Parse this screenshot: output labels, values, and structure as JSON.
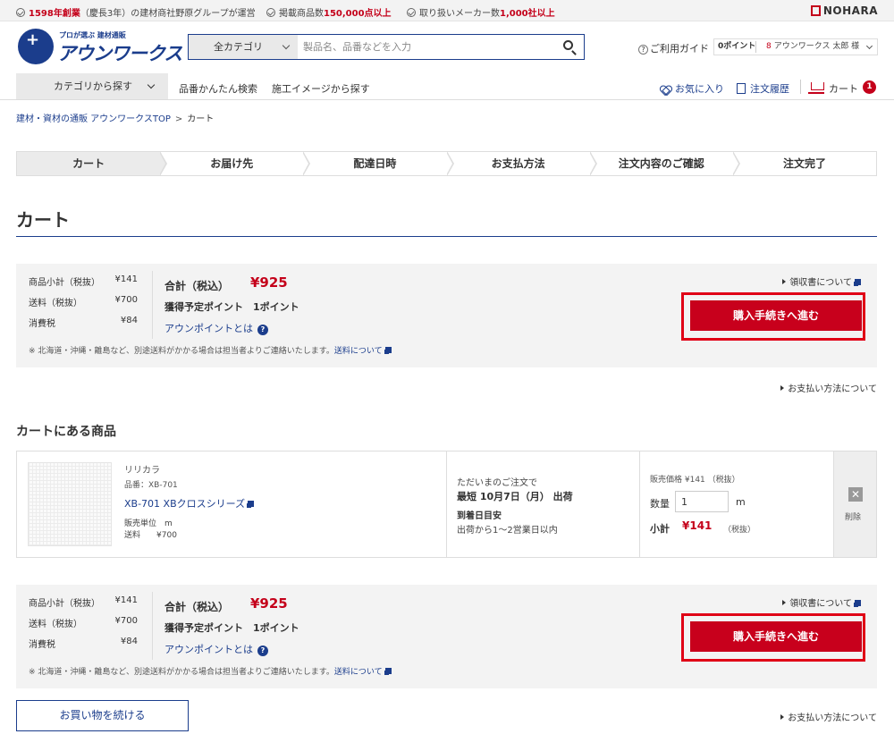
{
  "topbar": {
    "item1_pre": "",
    "item1_red": "1598年創業",
    "item1_post": "（慶長3年）の建材商社野原グループが運営",
    "item2_pre": "掲載商品数",
    "item2_red": "150,000点以上",
    "item3_pre": "取り扱いメーカー数",
    "item3_red": "1,000社以上",
    "brand": "NOHARA"
  },
  "logo": {
    "tagline": "プロが選ぶ 建材通販",
    "name": "アウンワークス"
  },
  "search": {
    "category": "全カテゴリ",
    "placeholder": "製品名、品番などを入力"
  },
  "header": {
    "guide": "ご利用ガイド",
    "points": "0ポイント",
    "user": "アウンワークス 太郎 様"
  },
  "nav": {
    "category_button": "カテゴリから探す",
    "links": [
      "品番かんたん検索",
      "施工イメージから探す"
    ],
    "favorites": "お気に入り",
    "orders": "注文履歴",
    "cart": "カート",
    "cart_count": "1"
  },
  "breadcrumb": {
    "home": "建材・資材の通販 アウンワークスTOP",
    "sep": ">",
    "current": "カート"
  },
  "steps": [
    "カート",
    "お届け先",
    "配達日時",
    "お支払方法",
    "注文内容のご確認",
    "注文完了"
  ],
  "page_title": "カート",
  "summary": {
    "subtotal_label": "商品小計（税抜）",
    "subtotal": "¥141",
    "shipping_label": "送料（税抜）",
    "shipping": "¥700",
    "tax_label": "消費税",
    "tax": "¥84",
    "total_label": "合計（税込）",
    "total": "¥925",
    "points_label": "獲得予定ポイント",
    "points": "1ポイント",
    "points_link": "アウンポイントとは",
    "note": "※ 北海道・沖縄・離島など、別途送料がかかる場合は担当者よりご連絡いたします。",
    "note_link": "送料について",
    "receipt_link": "領収書について",
    "buy_button": "購入手続きへ進む"
  },
  "payment_link": "お支払い方法について",
  "section_title": "カートにある商品",
  "item": {
    "maker": "リリカラ",
    "code": "品番：XB-701",
    "name": "XB-701 XBクロスシリーズ",
    "unit_label": "販売単位",
    "unit": "m",
    "ship_label": "送料",
    "ship": "¥700",
    "delivery_line1": "ただいまのご注文で",
    "delivery_line2": "最短 10月7日（月） 出荷",
    "delivery_line3": "到着日目安",
    "delivery_line4": "出荷から1〜2営業日以内",
    "price_label": "販売価格 ¥141 （税抜）",
    "qty_label": "数量",
    "qty": "1",
    "qty_unit": "m",
    "subtotal_label": "小計",
    "subtotal": "¥141",
    "subtotal_tax": "（税抜）",
    "delete_label": "削除"
  },
  "continue_button": "お買い物を続ける"
}
